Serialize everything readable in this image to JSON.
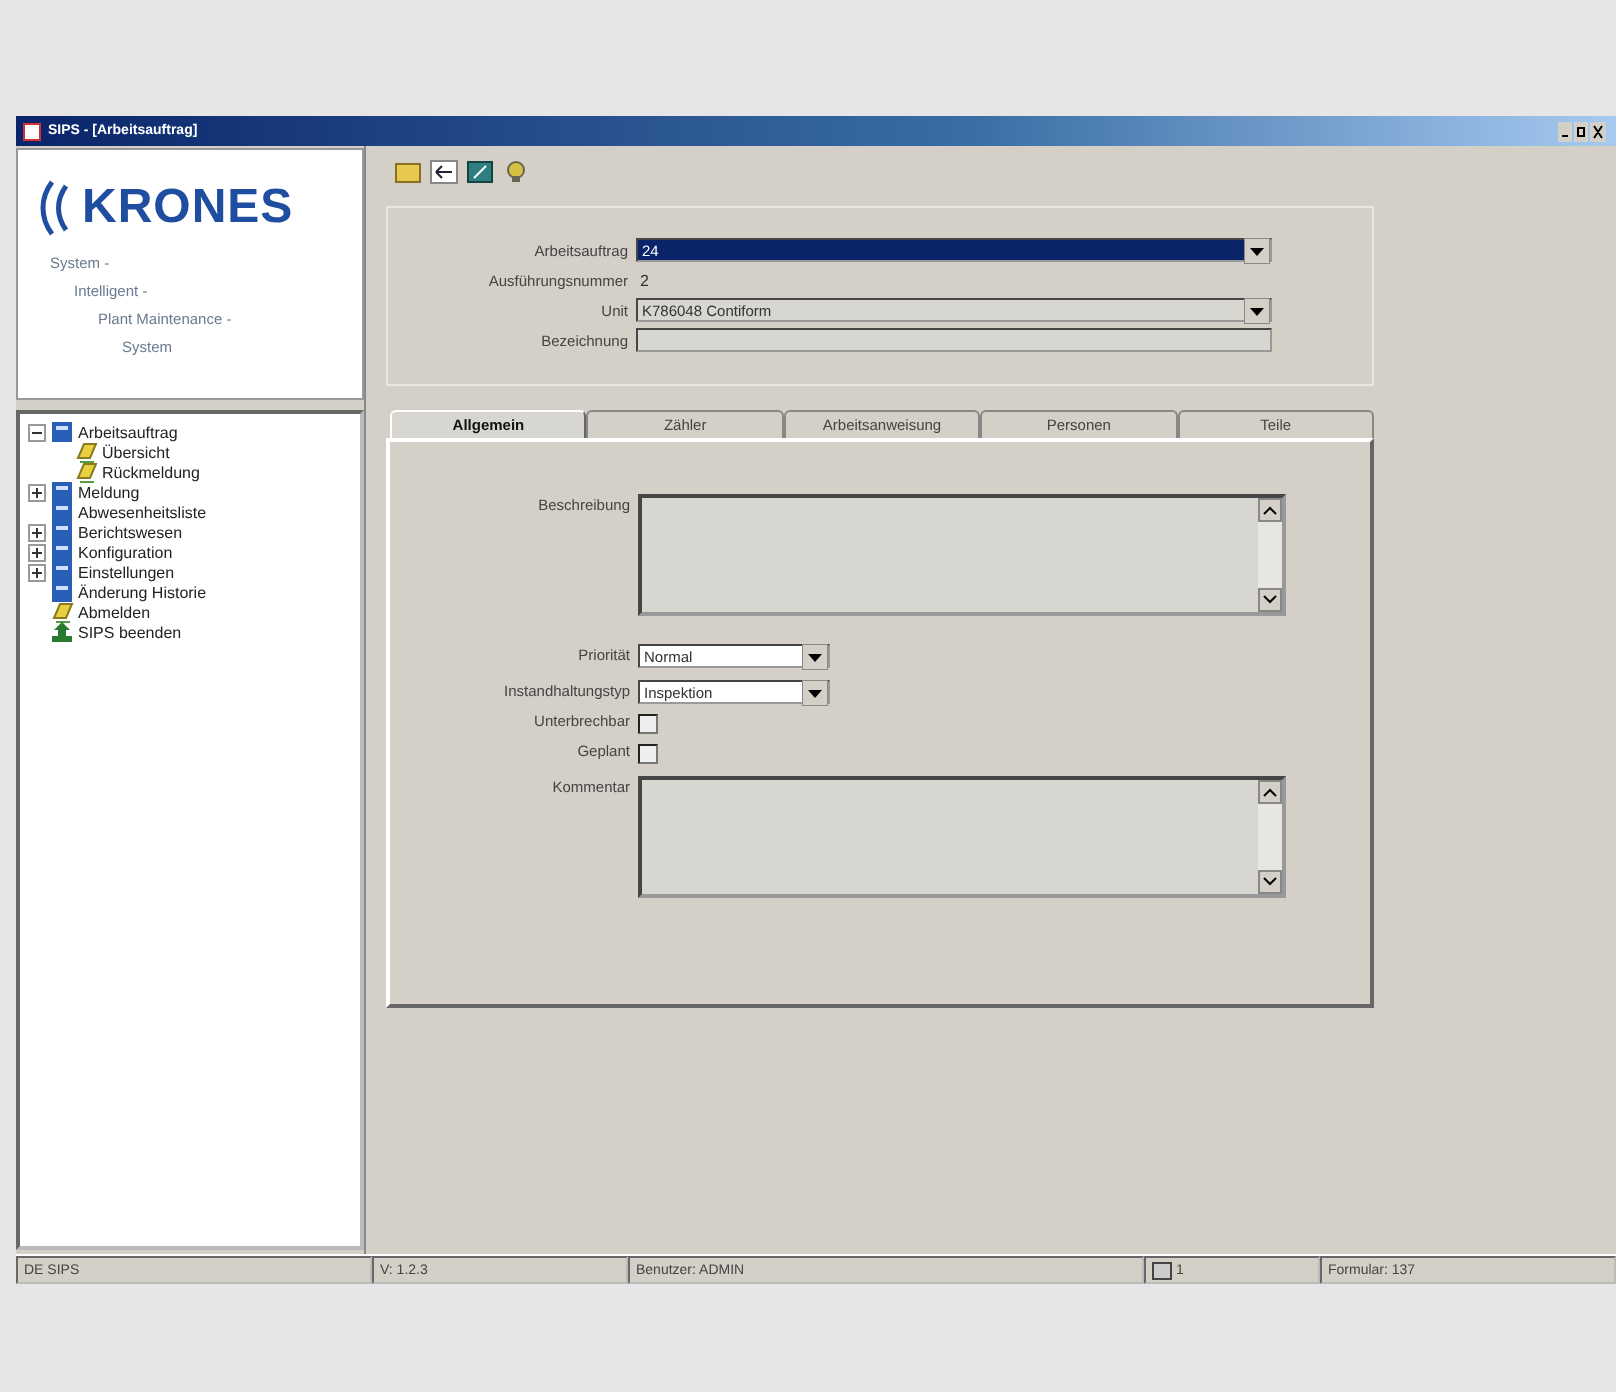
{
  "window": {
    "title": "SIPS - [Arbeitsauftrag]"
  },
  "logo": {
    "text": "KRONES",
    "lines": [
      "System -",
      "Intelligent -",
      "Plant Maintenance -",
      "System"
    ]
  },
  "tree": [
    {
      "label": "Arbeitsauftrag",
      "kind": "folder",
      "expanded": true,
      "children": [
        {
          "label": "Übersicht",
          "kind": "page"
        },
        {
          "label": "Rückmeldung",
          "kind": "page"
        }
      ]
    },
    {
      "label": "Meldung",
      "kind": "folder",
      "expanded": false
    },
    {
      "label": "Abwesenheitsliste",
      "kind": "folder"
    },
    {
      "label": "Berichtswesen",
      "kind": "folder",
      "expanded": false
    },
    {
      "label": "Konfiguration",
      "kind": "folder",
      "expanded": false
    },
    {
      "label": "Einstellungen",
      "kind": "folder",
      "expanded": false
    },
    {
      "label": "Änderung Historie",
      "kind": "folder"
    },
    {
      "label": "Abmelden",
      "kind": "page"
    },
    {
      "label": "SIPS beenden",
      "kind": "exit"
    }
  ],
  "header_form": [
    {
      "label": "Arbeitsauftrag",
      "kind": "dropdown",
      "value": "24",
      "selected": true
    },
    {
      "label": "Ausführungsnummer",
      "kind": "text",
      "value": "2"
    },
    {
      "label": "Unit",
      "kind": "dropdown",
      "value": "K786048  Contiform",
      "selected": false
    },
    {
      "label": "Bezeichnung",
      "kind": "input"
    }
  ],
  "tabs": [
    {
      "label": "Allgemein",
      "selected": true
    },
    {
      "label": "Zähler",
      "selected": false
    },
    {
      "label": "Arbeitsanweisung",
      "selected": false
    },
    {
      "label": "Personen",
      "selected": false
    },
    {
      "label": "Teile",
      "selected": false
    }
  ],
  "tab_form": [
    {
      "label": "Beschreibung",
      "kind": "textarea"
    },
    {
      "label": "Priorität",
      "kind": "dropdown",
      "value": "Normal"
    },
    {
      "label": "Instandhaltungstyp",
      "kind": "dropdown",
      "value": "Inspektion"
    },
    {
      "label": "Unterbrechbar",
      "kind": "checkbox",
      "checked": false
    },
    {
      "label": "Geplant",
      "kind": "checkbox",
      "checked": false
    },
    {
      "label": "Kommentar",
      "kind": "textarea"
    }
  ],
  "status_bar": [
    {
      "text": "DE SIPS"
    },
    {
      "text": "V: 1.2.3"
    },
    {
      "text": "Benutzer: ADMIN"
    },
    {
      "text": "1",
      "kind": "icon"
    },
    {
      "text": "Formular: 137"
    }
  ]
}
